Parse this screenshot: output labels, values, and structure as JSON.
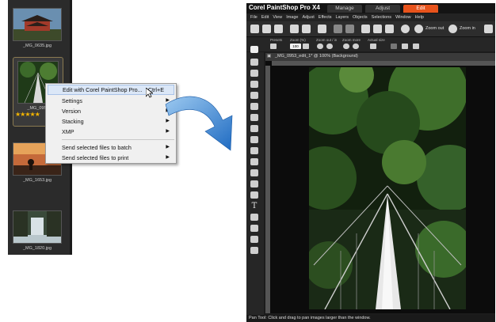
{
  "thumbnails": [
    {
      "caption": "_MG_0635.jpg"
    },
    {
      "caption": "_MG_0953",
      "stars": "★★★★★"
    },
    {
      "caption": "_MG_1653.jpg"
    },
    {
      "caption": "_MG_1820.jpg"
    }
  ],
  "context_menu": {
    "items": [
      {
        "label": "Edit with Corel PaintShop Pro...",
        "shortcut": "Ctrl+E"
      },
      {
        "label": "Settings",
        "arrow": "▶"
      },
      {
        "label": "Version",
        "arrow": "▶"
      },
      {
        "label": "Stacking",
        "arrow": "▶"
      },
      {
        "label": "XMP",
        "arrow": "▶"
      },
      {
        "label": "Send selected files to batch",
        "arrow": "▶"
      },
      {
        "label": "Send selected files to print",
        "arrow": "▶"
      }
    ]
  },
  "app": {
    "title": "Corel PaintShop Pro X4",
    "tabs": [
      "Manage",
      "Adjust",
      "Edit"
    ],
    "menu": [
      "File",
      "Edit",
      "View",
      "Image",
      "Adjust",
      "Effects",
      "Layers",
      "Objects",
      "Selections",
      "Window",
      "Help"
    ],
    "toolbar": {
      "zoom_out": "Zoom out",
      "zoom_in": "Zoom in"
    },
    "options": {
      "presets": "Presets",
      "zoom": "Zoom (%)",
      "zoom_value": "100",
      "zoom_outin": "Zoom out / in",
      "zoom_more": "Zoom more",
      "actual_size": "Actual size"
    },
    "document_title": "_MG_0953_edit_1* @ 100% (Background)",
    "status": "Pan Tool: Click and drag to pan images larger than the window."
  },
  "colors": {
    "accent": "#e8531c",
    "arrow": "#2f7fd3",
    "highlight": "#dbe7f7"
  }
}
